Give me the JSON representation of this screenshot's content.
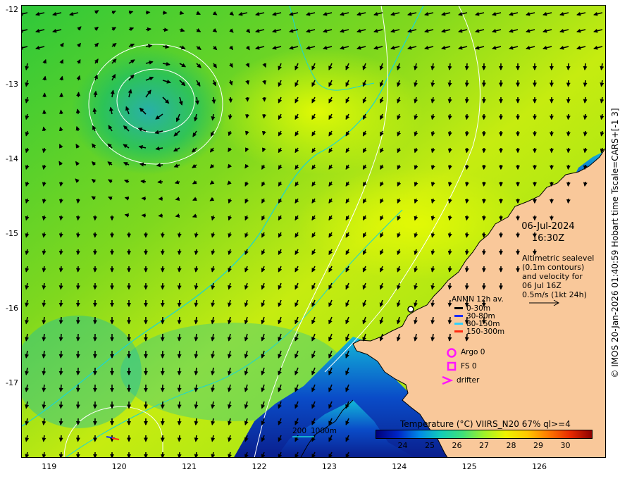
{
  "map": {
    "lon_ticks": [
      "119",
      "120",
      "121",
      "122",
      "123",
      "124",
      "125",
      "126"
    ],
    "lat_ticks": [
      "-12",
      "-13",
      "-14",
      "-15",
      "-16",
      "-17"
    ],
    "lon_range": [
      118.6,
      126.95
    ],
    "lat_range": [
      -11.93,
      -18.0
    ],
    "ocean_colors": [
      "#21c832",
      "#5fd41e",
      "#a8e614",
      "#d8f50a",
      "#eaff00"
    ],
    "land_color": "#f9c89a",
    "coast_deep_color": "#0a1e8c",
    "contour_color": "#ffffff",
    "bathy_color": "#19d6d6",
    "arrow_color": "#000000"
  },
  "side_label": "© IMOS 20-Jan-2026 01:40:59 Hobart time Tscale=CARS+[-1 3]",
  "date_block": {
    "date": "06-Jul-2024",
    "time": "16:30Z"
  },
  "altimetry_note": {
    "line1": "Altimetric sealevel",
    "line2": "(0.1m contours)",
    "line3": "and velocity for",
    "line4": "06 Jul 16Z",
    "line5": "0.5m/s (1kt 24h)"
  },
  "anmn_legend": {
    "title": "ANMN 12h av.",
    "rows": [
      {
        "label": "0-30m",
        "color": "#000000"
      },
      {
        "label": "30-80m",
        "color": "#1a2cff"
      },
      {
        "label": "80-150m",
        "color": "#2ed1ff"
      },
      {
        "label": "150-300m",
        "color": "#ff2a10"
      }
    ]
  },
  "platform_legend": {
    "argo": "Argo 0",
    "fs": "FS 0",
    "drifter": "drifter",
    "marker_color": "#ff14ff"
  },
  "bathy_legend": {
    "label_a": "200",
    "label_b": "1000m"
  },
  "colorbar": {
    "title": "Temperature (°C) VIIRS_N20 67% ql>=4",
    "ticks": [
      "24",
      "25",
      "26",
      "27",
      "28",
      "29",
      "30"
    ],
    "colors": [
      "#00007a",
      "#0025c6",
      "#0089e6",
      "#12cdb8",
      "#3fe07a",
      "#9ef22a",
      "#eef300",
      "#ffc800",
      "#ff7800",
      "#e82a00",
      "#8c0000"
    ]
  }
}
